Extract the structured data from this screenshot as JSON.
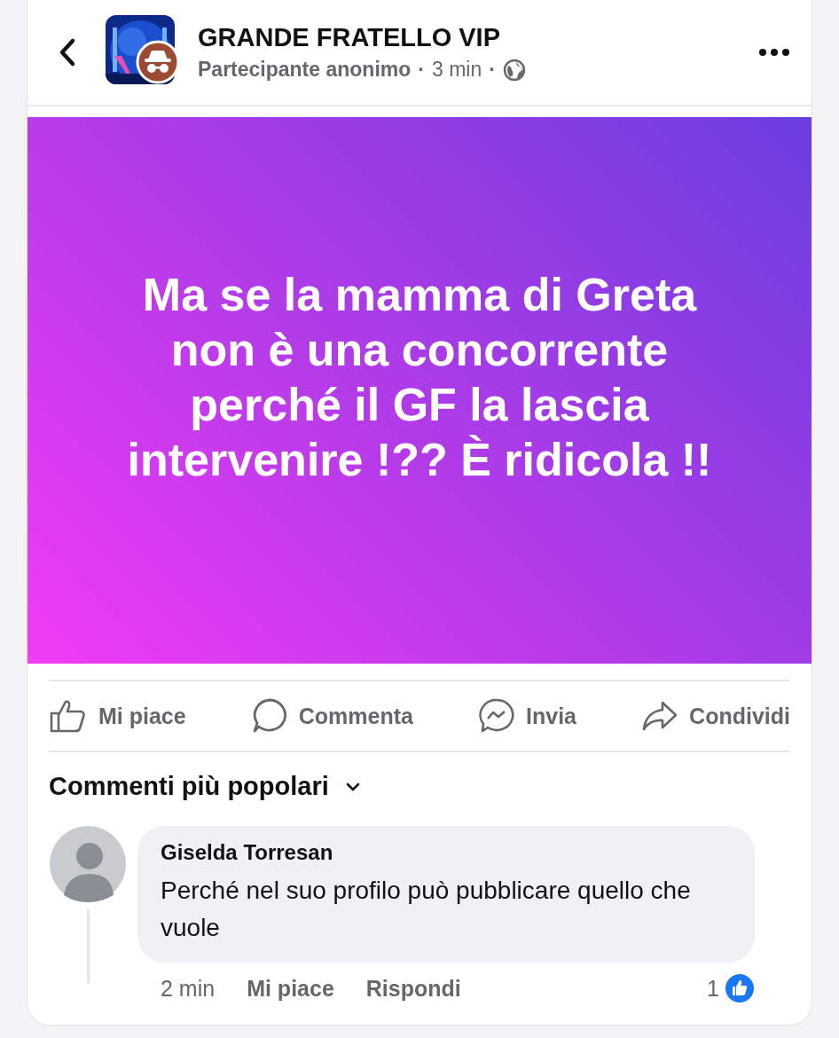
{
  "header": {
    "group_name": "GRANDE FRATELLO VIP",
    "author": "Partecipante anonimo",
    "time": "3 min",
    "separator": "·"
  },
  "post": {
    "text": "Ma se la mamma di Greta non è una concorrente perché il GF la lascia intervenire !?? È ridicola !!"
  },
  "actions": [
    {
      "kind": "like",
      "label": "Mi piace"
    },
    {
      "kind": "comment",
      "label": "Commenta"
    },
    {
      "kind": "send",
      "label": "Invia"
    },
    {
      "kind": "share",
      "label": "Condividi"
    }
  ],
  "comments_sort": {
    "label": "Commenti più popolari"
  },
  "comments": [
    {
      "author": "Giselda Torresan",
      "text": "Perché nel suo profilo può pubblicare quello che vuole",
      "time": "2 min",
      "like_label": "Mi piace",
      "reply_label": "Rispondi",
      "reactions": "1"
    }
  ]
}
